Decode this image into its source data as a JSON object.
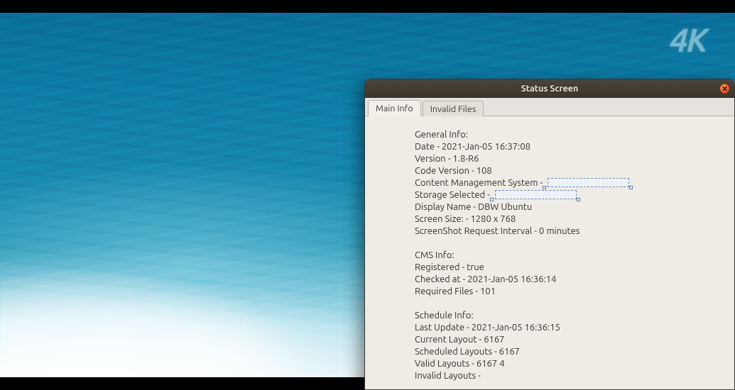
{
  "background_watermark": "4K",
  "dialog": {
    "title": "Status Screen",
    "tabs": [
      {
        "id": "main-info",
        "label": "Main Info",
        "selected": true
      },
      {
        "id": "invalid-files",
        "label": "Invalid Files",
        "selected": false
      }
    ],
    "general": {
      "heading": "General Info:",
      "date": "Date - 2021-Jan-05 16:37:08",
      "version": "Version - 1.8-R6",
      "code_ver": "Code Version - 108",
      "cms_label": "Content Management System -",
      "storage": "Storage Selected -",
      "display": "Display Name - DBW Ubuntu",
      "screen": "Screen Size: - 1280 x 768",
      "ss_int": "ScreenShot Request Interval - 0 minutes"
    },
    "cms": {
      "heading": "CMS Info:",
      "registered": "Registered - true",
      "checked": "Checked at - 2021-Jan-05 16:36:14",
      "required": "Required Files - 101"
    },
    "schedule": {
      "heading": "Schedule Info:",
      "last": "Last Update - 2021-Jan-05 16:36:15",
      "current": "Current Layout - 6167",
      "scheduled": "Scheduled Layouts - 6167",
      "valid": "Valid Layouts - 6167 4",
      "invalid": "Invalid Layouts -"
    }
  }
}
